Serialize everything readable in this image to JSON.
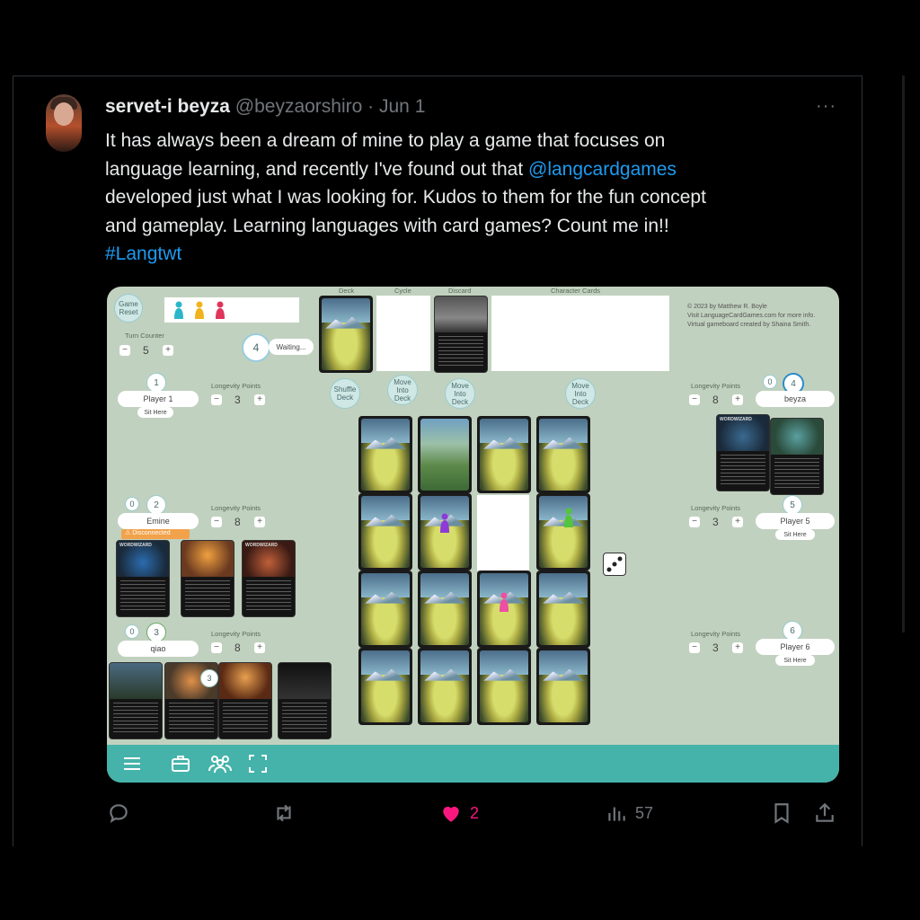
{
  "tweet": {
    "display_name": "servet-i beyza",
    "handle": "@beyzaorshiro",
    "separator": "·",
    "date": "Jun 1",
    "more": "···",
    "lines": [
      {
        "pre": "It has always been a dream of mine to play a game that focuses on",
        "link": "",
        "post": ""
      },
      {
        "pre": "language learning, and recently I've found out that ",
        "link": "@langcardgames",
        "post": ""
      },
      {
        "pre": "developed just what I was looking for. Kudos to them for the fun concept",
        "link": "",
        "post": ""
      },
      {
        "pre": "and gameplay. Learning languages with card games? Count me in!!",
        "link": "",
        "post": ""
      },
      {
        "pre": "",
        "link": "#Langtwt",
        "post": ""
      }
    ]
  },
  "actions": {
    "reply": "",
    "retweet": "",
    "like_count": "2",
    "views_count": "57",
    "like_color": "#f91880"
  },
  "board": {
    "game_reset": "Game Reset",
    "turn_counter_label": "Turn Counter",
    "turn_counter": "5",
    "waiting_num": "4",
    "waiting_label": "Waiting...",
    "pile_labels": {
      "deck": "Deck",
      "cycle": "Cycle",
      "discard": "Discard",
      "character": "Character Cards"
    },
    "credits": [
      "© 2023 by Matthew R. Boyle",
      "Visit LanguageCardGames.com for more info.",
      "Virtual gameboard created by Shaina Smith."
    ],
    "buttons": {
      "shuffle": "Shuffle Deck",
      "move1": "Move Into Deck",
      "move2": "Move Into Deck",
      "move3": "Move Into Deck"
    },
    "longevity_label": "Longevity Points",
    "sit_here": "Sit Here",
    "disconnected": "⚠ Disconnected",
    "players": {
      "p1": {
        "num": "1",
        "name": "Player 1",
        "points": "3"
      },
      "p2": {
        "num": "2",
        "name": "Emine",
        "points": "8",
        "count": "0"
      },
      "p3": {
        "num": "3",
        "name": "qiao",
        "points": "8",
        "count": "0"
      },
      "p4": {
        "num": "4",
        "name": "beyza",
        "points": "8",
        "count": "0"
      },
      "p5": {
        "num": "5",
        "name": "Player 5",
        "points": "3"
      },
      "p6": {
        "num": "6",
        "name": "Player 6",
        "points": "3"
      }
    },
    "hand_badge": "3",
    "card_title": "WORDWIZARD",
    "colors": {
      "teal": "#45b3aa",
      "board": "#c1d1bf",
      "pawn_blue": "#2bb6c9",
      "pawn_yellow": "#f2b21b",
      "pawn_red": "#e0345a",
      "pawn_purple": "#8e3ad6",
      "pawn_green": "#54c43c",
      "pawn_pink": "#ee4fa4"
    }
  }
}
